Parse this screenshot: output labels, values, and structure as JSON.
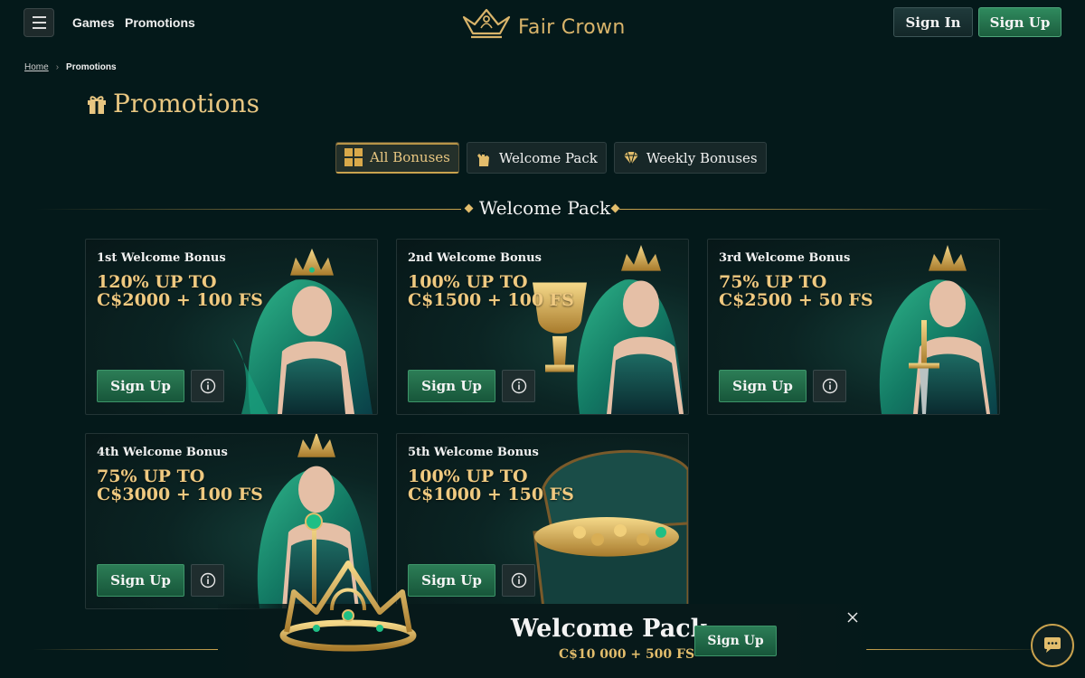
{
  "header": {
    "brand": "Fair Crown",
    "nav": [
      "Games",
      "Promotions"
    ],
    "sign_in": "Sign In",
    "sign_up": "Sign Up"
  },
  "breadcrumb": {
    "home": "Home",
    "current": "Promotions"
  },
  "page_title": "Promotions",
  "tabs": [
    {
      "label": "All Bonuses",
      "icon": "grid-icon",
      "active": true
    },
    {
      "label": "Welcome Pack",
      "icon": "hand-icon",
      "active": false
    },
    {
      "label": "Weekly Bonuses",
      "icon": "diamond-icon",
      "active": false
    }
  ],
  "section_title": "Welcome Pack",
  "cards": [
    {
      "title": "1st Welcome Bonus",
      "offer": "120% UP TO C$2000 + 100 FS",
      "cta": "Sign Up",
      "art": "queen-portrait"
    },
    {
      "title": "2nd Welcome Bonus",
      "offer": "100% UP TO C$1500 + 100 FS",
      "cta": "Sign Up",
      "art": "queen-with-trophy"
    },
    {
      "title": "3rd Welcome Bonus",
      "offer": "75% UP TO C$2500 + 50 FS",
      "cta": "Sign Up",
      "art": "queen-with-sword"
    },
    {
      "title": "4th Welcome Bonus",
      "offer": "75% UP TO C$3000 + 100 FS",
      "cta": "Sign Up",
      "art": "queen-with-scepter"
    },
    {
      "title": "5th Welcome Bonus",
      "offer": "100% UP TO C$1000 + 150 FS",
      "cta": "Sign Up",
      "art": "treasure-chest"
    }
  ],
  "banner": {
    "title": "Welcome Pack",
    "subtitle": "C$10 000 + 500 FS",
    "cta": "Sign Up"
  },
  "colors": {
    "background": "#04191a",
    "gold": "#e2bd6c",
    "green_button": "#2c7d56",
    "teal_button": "#1f3a3b"
  }
}
